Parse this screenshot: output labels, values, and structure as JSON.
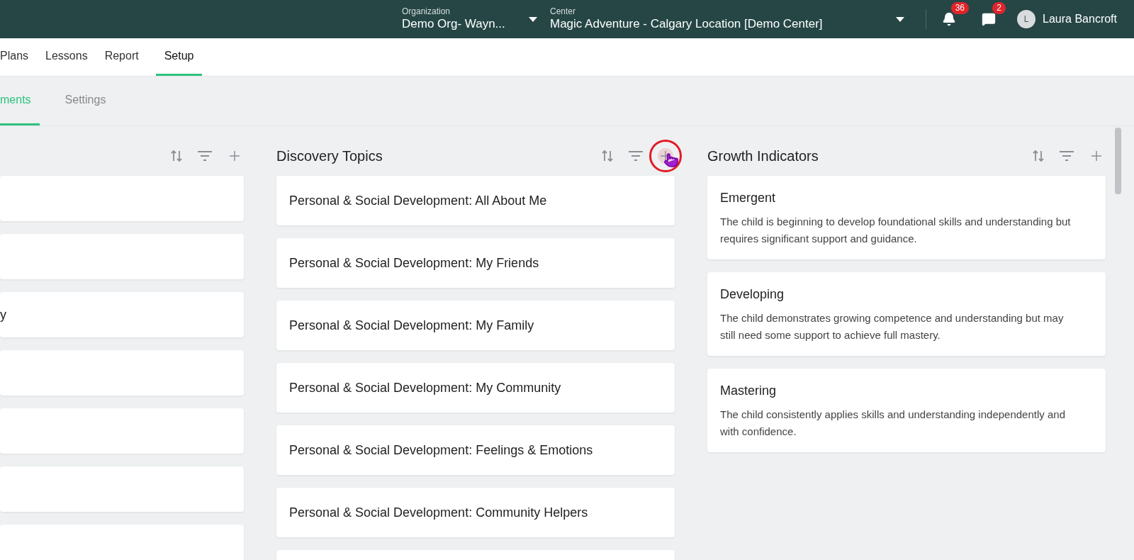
{
  "top_bar": {
    "organization": {
      "label": "Organization",
      "value": "Demo Org- Wayn..."
    },
    "center": {
      "label": "Center",
      "value": "Magic Adventure - Calgary Location [Demo Center]"
    },
    "notifications": {
      "count": "36"
    },
    "messages": {
      "count": "2"
    },
    "user": {
      "initial": "L",
      "name": "Laura Bancroft"
    }
  },
  "nav_tabs": [
    {
      "label": "Plans",
      "selected": false
    },
    {
      "label": "Lessons",
      "selected": false
    },
    {
      "label": "Report",
      "selected": false
    },
    {
      "label": "Setup",
      "selected": true
    }
  ],
  "sub_tabs": [
    {
      "label": "ments",
      "selected": true
    },
    {
      "label": "Settings",
      "selected": false
    }
  ],
  "columns": [
    {
      "cards": [
        {
          "kind": "blank"
        },
        {
          "kind": "blank"
        },
        {
          "kind": "topic",
          "title": "y"
        },
        {
          "kind": "blank"
        },
        {
          "kind": "blank"
        },
        {
          "kind": "blank"
        },
        {
          "kind": "blank"
        }
      ]
    },
    {
      "title": "Discovery Topics",
      "click_highlight": true,
      "cards": [
        {
          "title": "Personal & Social Development: All About Me"
        },
        {
          "title": "Personal & Social Development: My Friends"
        },
        {
          "title": "Personal & Social Development: My Family"
        },
        {
          "title": "Personal & Social Development: My Community"
        },
        {
          "title": "Personal & Social Development: Feelings & Emotions"
        },
        {
          "title": "Personal & Social Development: Community Helpers"
        },
        {
          "kind": "blank"
        }
      ]
    },
    {
      "title": "Growth Indicators",
      "cards": [
        {
          "title": "Emergent",
          "description": "The child is beginning to develop foundational skills and understanding but requires significant support and guidance."
        },
        {
          "title": "Developing",
          "description": "The child demonstrates growing competence and understanding but may still need some support to achieve full mastery."
        },
        {
          "title": "Mastering",
          "description": "The child consistently applies skills and understanding independently and with confidence."
        }
      ]
    }
  ]
}
